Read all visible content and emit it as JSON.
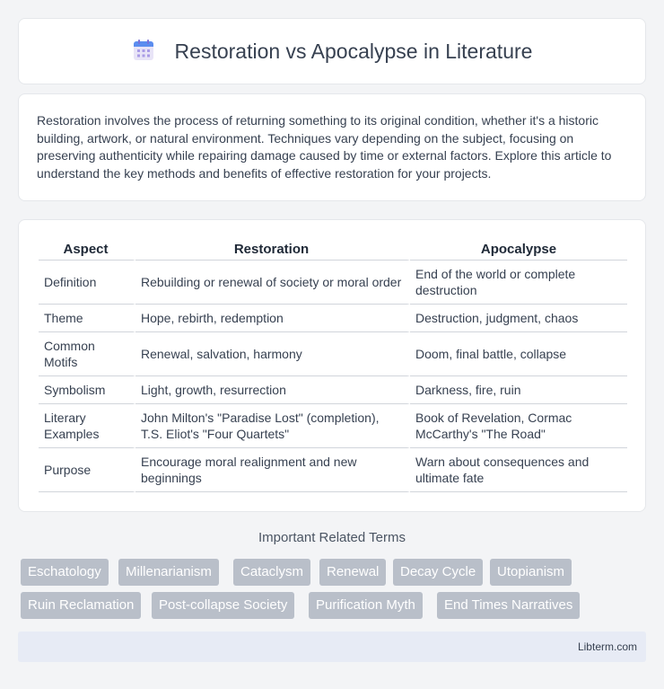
{
  "header": {
    "title": "Restoration vs Apocalypse in Literature",
    "icon": "calendar-icon"
  },
  "intro": {
    "text": "Restoration involves the process of returning something to its original condition, whether it's a historic building, artwork, or natural environment. Techniques vary depending on the subject, focusing on preserving authenticity while repairing damage caused by time or external factors. Explore this article to understand the key methods and benefits of effective restoration for your projects."
  },
  "table": {
    "headers": [
      "Aspect",
      "Restoration",
      "Apocalypse"
    ],
    "rows": [
      [
        "Definition",
        "Rebuilding or renewal of society or moral order",
        "End of the world or complete destruction"
      ],
      [
        "Theme",
        "Hope, rebirth, redemption",
        "Destruction, judgment, chaos"
      ],
      [
        "Common Motifs",
        "Renewal, salvation, harmony",
        "Doom, final battle, collapse"
      ],
      [
        "Symbolism",
        "Light, growth, resurrection",
        "Darkness, fire, ruin"
      ],
      [
        "Literary Examples",
        "John Milton's \"Paradise Lost\" (completion), T.S. Eliot's \"Four Quartets\"",
        "Book of Revelation, Cormac McCarthy's \"The Road\""
      ],
      [
        "Purpose",
        "Encourage moral realignment and new beginnings",
        "Warn about consequences and ultimate fate"
      ]
    ]
  },
  "related": {
    "title": "Important Related Terms",
    "tags": [
      "Eschatology",
      "Millenarianism",
      "Cataclysm",
      "Renewal",
      "Decay Cycle",
      "Utopianism",
      "Ruin Reclamation",
      "Post-collapse Society",
      "Purification Myth",
      "End Times Narratives"
    ]
  },
  "footer": {
    "text": "Libterm.com"
  }
}
